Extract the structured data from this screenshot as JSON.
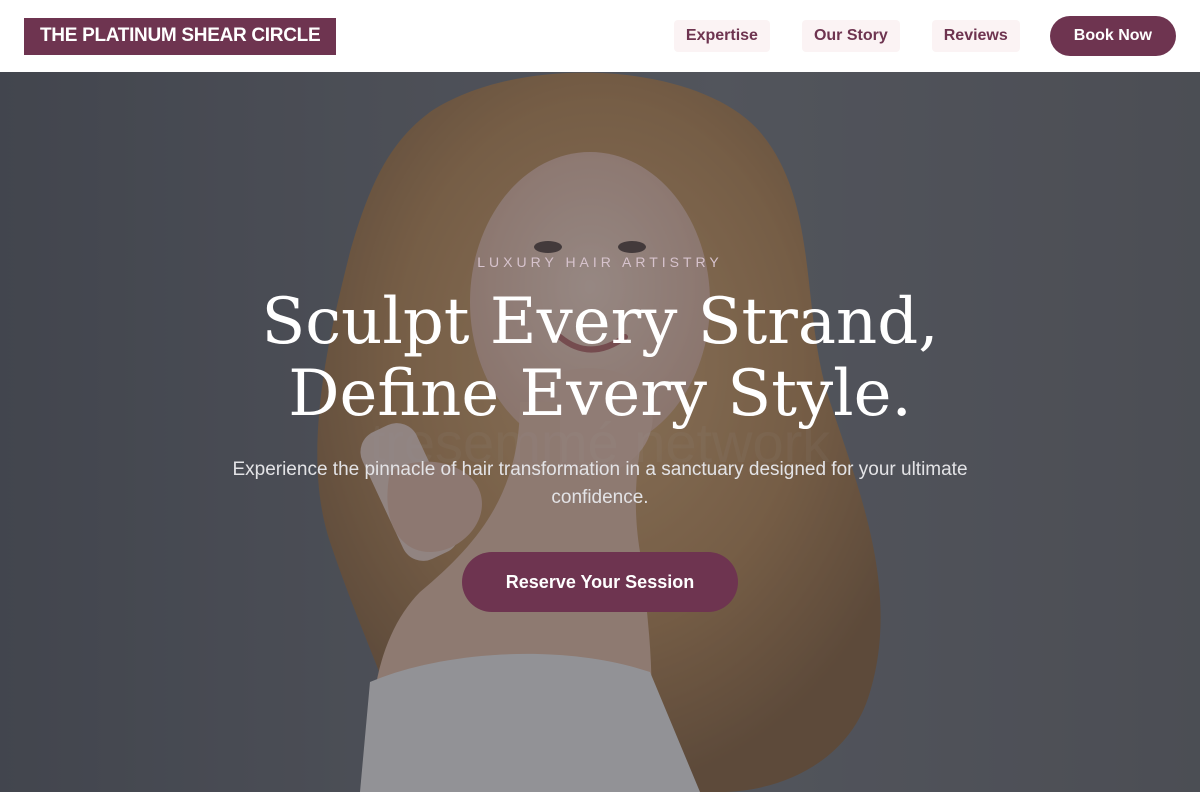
{
  "header": {
    "logo_text": "THE PLATINUM SHEAR CIRCLE",
    "nav": [
      {
        "label": "Expertise"
      },
      {
        "label": "Our Story"
      },
      {
        "label": "Reviews"
      }
    ],
    "book_button_label": "Book Now"
  },
  "hero": {
    "eyebrow": "LUXURY HAIR ARTISTRY",
    "headline_line1": "Sculpt Every Strand,",
    "headline_line2": "Define Every Style.",
    "subtext": "Experience the pinnacle of hair transformation in a sanctuary designed for your ultimate confidence.",
    "cta_label": "Reserve Your Session",
    "image_watermark": "tresemmé network"
  },
  "colors": {
    "brand": "#6e3450",
    "nav_bg": "#fbf3f4",
    "eyebrow": "#d7c3cd",
    "overlay": "rgba(38,40,48,0.45)"
  }
}
